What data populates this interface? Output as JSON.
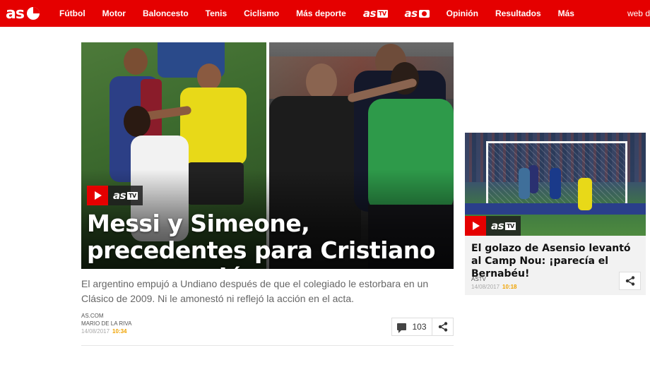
{
  "nav": {
    "items": [
      {
        "label": "Fútbol"
      },
      {
        "label": "Motor"
      },
      {
        "label": "Baloncesto"
      },
      {
        "label": "Tenis"
      },
      {
        "label": "Ciclismo"
      },
      {
        "label": "Más deporte"
      },
      {
        "label": "as",
        "badge": "TV"
      },
      {
        "label": "as"
      },
      {
        "label": "Opinión"
      },
      {
        "label": "Resultados"
      },
      {
        "label": "Más"
      }
    ],
    "right_label": "web d",
    "accent": "#e50000"
  },
  "hero": {
    "title": "Messi y Simeone, precedentes para Cristiano y su empujón",
    "video_brand": "as",
    "video_tag": "TV",
    "summary": "El argentino empujó a Undiano después de que el colegiado le estorbara en un Clásico de 2009. Ni le amonestó ni reflejó la acción en el acta.",
    "source": "AS.COM",
    "author": "MARIO DE LA RIVA",
    "date": "14/08/2017",
    "time": "10:34",
    "comments": "103"
  },
  "side": {
    "title": "El golazo de Asensio levantó al Camp Nou: ¡parecía el Bernabéu!",
    "video_brand": "as",
    "video_tag": "TV",
    "source": "ASTV",
    "date": "14/08/2017",
    "time": "10:18"
  }
}
